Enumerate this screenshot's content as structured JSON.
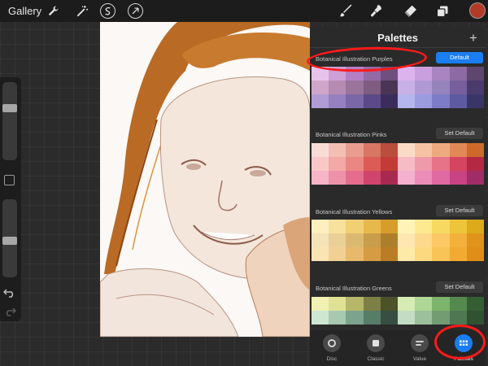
{
  "app": {
    "gallery_label": "Gallery",
    "current_color": "#b33a26",
    "toolbar_icons": [
      "wrench-icon",
      "magic-wand-icon",
      "selection-icon",
      "transform-arrow-icon",
      "brush-icon",
      "smudge-icon",
      "eraser-icon",
      "layers-icon"
    ]
  },
  "panel": {
    "title": "Palettes",
    "add_label": "+",
    "palettes": [
      {
        "name": "Botanical Illustration Purples",
        "button_label": "Default",
        "is_default": true,
        "colors": [
          "#e7c3ea",
          "#cf9fd8",
          "#b47fc4",
          "#946aa6",
          "#6e4f7d",
          "#dcb3ec",
          "#c9a0dd",
          "#a884c1",
          "#8d6aa2",
          "#5e466e",
          "#cfa6c9",
          "#b58bb3",
          "#9a749a",
          "#7e5d80",
          "#4b3554",
          "#c7b0e6",
          "#b09ad6",
          "#9484bb",
          "#765f9c",
          "#4b3a6c",
          "#b19bd4",
          "#9680c0",
          "#7a67a8",
          "#5c4a88",
          "#3b2d5b",
          "#b5b6ee",
          "#9b9ce0",
          "#7c7cc7",
          "#5d5a9f",
          "#3a3567"
        ]
      },
      {
        "name": "Botanical Illustration Pinks",
        "button_label": "Set Default",
        "is_default": false,
        "colors": [
          "#fadcd6",
          "#f3bfb3",
          "#e99d8e",
          "#d77665",
          "#bb4d3c",
          "#fbdbc7",
          "#f5c3a4",
          "#eeaa7f",
          "#e18856",
          "#cd6a2b",
          "#f9c9c7",
          "#f3a9a6",
          "#eb8783",
          "#dc5b57",
          "#c33a36",
          "#f6bcc5",
          "#ef9aaa",
          "#e77389",
          "#d5455f",
          "#b52844",
          "#f7b5c8",
          "#ee92ab",
          "#e46d8d",
          "#d0456d",
          "#a82a50",
          "#f4b0cf",
          "#eb8db8",
          "#df6aa1",
          "#c84383",
          "#a02d67"
        ]
      },
      {
        "name": "Botanical Illustration Yellows",
        "button_label": "Set Default",
        "is_default": false,
        "colors": [
          "#fcefc0",
          "#f8e19c",
          "#f1cf73",
          "#e7b94c",
          "#d79d2a",
          "#fff3b8",
          "#fde990",
          "#f7d961",
          "#eec43a",
          "#dcaa1b",
          "#f4e3b8",
          "#ead097",
          "#dcb970",
          "#c89d4b",
          "#ad7f2c",
          "#fee7b0",
          "#fdd98e",
          "#fbc865",
          "#f3b03a",
          "#e0941b",
          "#f9e4b4",
          "#f2d094",
          "#e8b86d",
          "#d69c44",
          "#ba7d26",
          "#fdeaa8",
          "#fcd97f",
          "#f8c458",
          "#f1ab33",
          "#e08e17"
        ]
      },
      {
        "name": "Botanical Illustration Greens",
        "button_label": "Set Default",
        "is_default": false,
        "colors": [
          "#f0f1b2",
          "#dfe295",
          "#b7b76a",
          "#7e7f45",
          "#4c5128",
          "#d6ecb5",
          "#aed695",
          "#7db46c",
          "#558a4e",
          "#355e35",
          "#cfe6d2",
          "#a7c9b0",
          "#7ca48c",
          "#577c68",
          "#364f42",
          "#c5dcc4",
          "#9cbf9c",
          "#739c73",
          "#4f7751",
          "#325133"
        ]
      }
    ],
    "tabs": [
      {
        "label": "Disc",
        "icon": "disc-icon",
        "active": false
      },
      {
        "label": "Classic",
        "icon": "classic-square-icon",
        "active": false
      },
      {
        "label": "Value",
        "icon": "value-sliders-icon",
        "active": false
      },
      {
        "label": "Palettes",
        "icon": "palettes-grid-icon",
        "active": true
      }
    ]
  },
  "annotations": {
    "color": "#ff1a1a",
    "highlighted": [
      "palette-name-purples",
      "tab-palettes"
    ]
  }
}
